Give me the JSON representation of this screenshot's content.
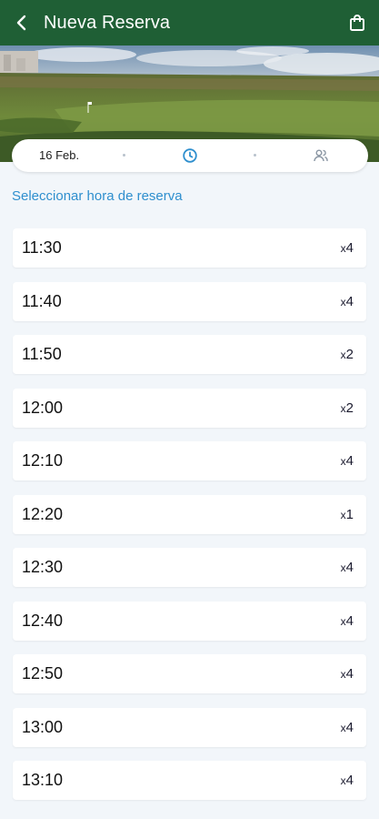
{
  "appbar": {
    "title": "Nueva Reserva",
    "back_icon": "chevron-left-icon",
    "bag_icon": "shopping-bag-icon",
    "color": "#1f5f35"
  },
  "stepper": {
    "date": "16 Feb.",
    "time_icon": "clock-icon",
    "players_icon": "users-icon",
    "active_color": "#2f8fce"
  },
  "section": {
    "title": "Seleccionar hora de reserva"
  },
  "slots": [
    {
      "time": "11:30",
      "prefix": "x",
      "count": "4"
    },
    {
      "time": "11:40",
      "prefix": "x",
      "count": "4"
    },
    {
      "time": "11:50",
      "prefix": "x",
      "count": "2"
    },
    {
      "time": "12:00",
      "prefix": "x",
      "count": "2"
    },
    {
      "time": "12:10",
      "prefix": "x",
      "count": "4"
    },
    {
      "time": "12:20",
      "prefix": "x",
      "count": "1"
    },
    {
      "time": "12:30",
      "prefix": "x",
      "count": "4"
    },
    {
      "time": "12:40",
      "prefix": "x",
      "count": "4"
    },
    {
      "time": "12:50",
      "prefix": "x",
      "count": "4"
    },
    {
      "time": "13:00",
      "prefix": "x",
      "count": "4"
    },
    {
      "time": "13:10",
      "prefix": "x",
      "count": "4"
    }
  ]
}
